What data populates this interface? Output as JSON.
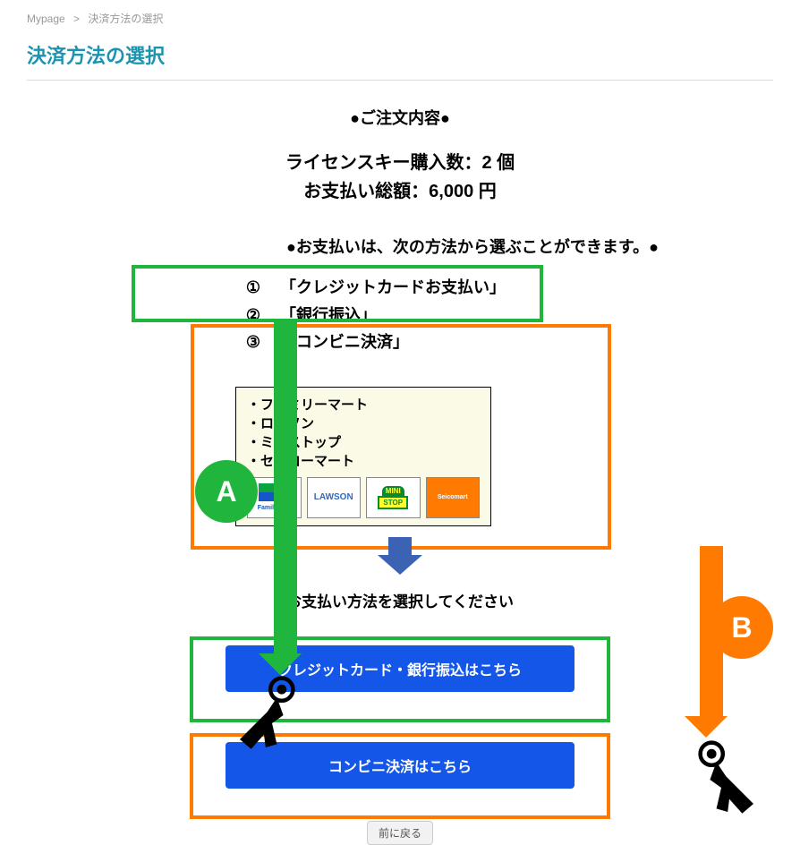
{
  "breadcrumb": {
    "home": "Mypage",
    "sep": ">",
    "current": "決済方法の選択"
  },
  "page_title": "決済方法の選択",
  "order_heading": "●ご注文内容●",
  "order": {
    "line1": "ライセンスキー購入数：2 個",
    "line2": "お支払い総額：6,000 円"
  },
  "payment_note": "●お支払いは、次の方法から選ぶことができます。●",
  "options": [
    {
      "num": "①",
      "label": "「クレジットカードお支払い」"
    },
    {
      "num": "②",
      "label": "「銀行振込」"
    },
    {
      "num": "③",
      "label": "「コンビニ決済」"
    }
  ],
  "convenience": {
    "s1": "・ファミリーマート",
    "s2": "・ローソン",
    "s3": "・ミニストップ",
    "s4": "・セイコーマート",
    "logos": {
      "famima": "FamilyMart",
      "lawson": "LAWSON",
      "mini1": "MINI",
      "mini2": "STOP",
      "seico": "Seicomart"
    }
  },
  "choose_note": "お支払い方法を選択してください",
  "buttons": {
    "credit_bank": "クレジットカード・銀行振込はこちら",
    "conv": "コンビニ決済はこちら",
    "back": "前に戻る"
  },
  "badges": {
    "a": "A",
    "b": "B"
  }
}
